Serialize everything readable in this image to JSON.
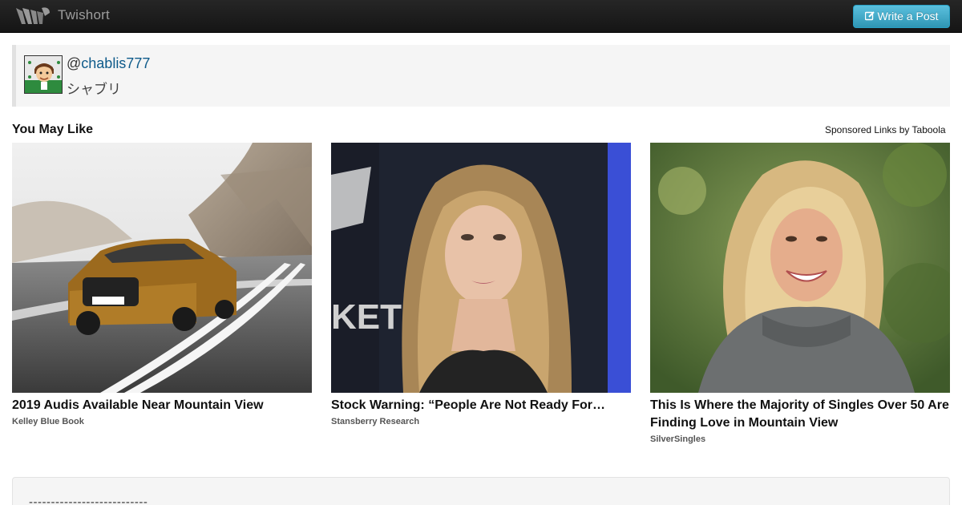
{
  "navbar": {
    "brand": "Twishort",
    "write_button": "Write a Post",
    "write_icon": "edit-icon"
  },
  "author": {
    "at": "@",
    "handle": "chablis777",
    "display_name": "シャブリ"
  },
  "recommendations": {
    "title": "You May Like",
    "sponsored": "Sponsored Links by Taboola",
    "items": [
      {
        "headline": "2019 Audis Available Near Mountain View",
        "source": "Kelley Blue Book"
      },
      {
        "headline": "Stock Warning: “People Are Not Ready For…",
        "source": "Stansberry Research"
      },
      {
        "headline": "This Is Where the Majority of Singles Over 50 Are Finding Love in Mountain View",
        "source": "SilverSingles"
      }
    ]
  },
  "post": {
    "text": "---------------------------"
  },
  "colors": {
    "accent": "#5bc0de",
    "link": "#0e5a8a",
    "navbar": "#1b1b1b"
  }
}
